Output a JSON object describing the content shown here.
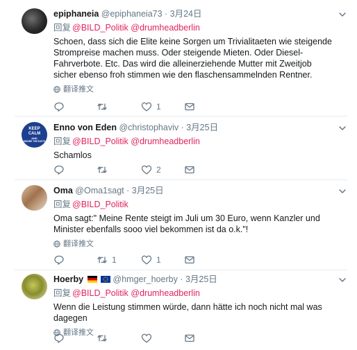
{
  "tweets": [
    {
      "name": "epiphaneia",
      "handle": "@epiphaneia73",
      "sep": " · ",
      "date": "3月24日",
      "reply_label": "回复",
      "mentions": "@BILD_Politik @drumheadberlin",
      "text": "Schoen, dass sich die Elite keine Sorgen um Trivialitaeten wie steigende Strompreise machen muss. Oder steigende Mieten. Oder Diesel-Fahrverbote. Etc. Das wird die alleinerziehende Mutter mit Zweitjob sicher ebenso froh stimmen wie den flaschensammelnden Rentner.",
      "translate": "翻译推文",
      "replies": "",
      "retweets": "",
      "likes": "1"
    },
    {
      "name": "Enno von Eden",
      "handle": "@christophaviv",
      "sep": " · ",
      "date": "3月25日",
      "reply_label": "回复",
      "mentions": "@BILD_Politik @drumheadberlin",
      "text": "Schamlos",
      "avatar_text": [
        "KEEP",
        "CALM",
        "AND",
        "IGNORE THE IDIOTS"
      ],
      "replies": "",
      "retweets": "",
      "likes": "2"
    },
    {
      "name": "Oma",
      "handle": "@Oma1sagt",
      "sep": " · ",
      "date": "3月25日",
      "reply_label": "回复",
      "mentions": "@BILD_Politik",
      "text": "Oma sagt:\" Meine Rente steigt im Juli um 30 Euro, wenn Kanzler und Minister ebenfalls sooo viel bekommen ist da o.k.\"!",
      "translate": "翻译推文",
      "replies": "",
      "retweets": "1",
      "likes": "1"
    },
    {
      "name": "Hoerby",
      "handle": "@hmger_hoerby",
      "sep": " · ",
      "date": "3月25日",
      "reply_label": "回复",
      "mentions": "@BILD_Politik @drumheadberlin",
      "text": "Wenn die Leistung stimmen würde, dann hätte ich noch nicht mal was dagegen",
      "translate": "翻译推文",
      "replies": "",
      "retweets": "",
      "likes": ""
    }
  ],
  "colors": {
    "text": "#14171a",
    "muted": "#657786",
    "mention": "#e0245e",
    "divider": "#e6ecf0"
  },
  "icons": [
    "reply-icon",
    "retweet-icon",
    "like-icon",
    "dm-icon",
    "chevron-down-icon",
    "globe-icon",
    "germany-flag-icon",
    "eu-flag-icon"
  ]
}
